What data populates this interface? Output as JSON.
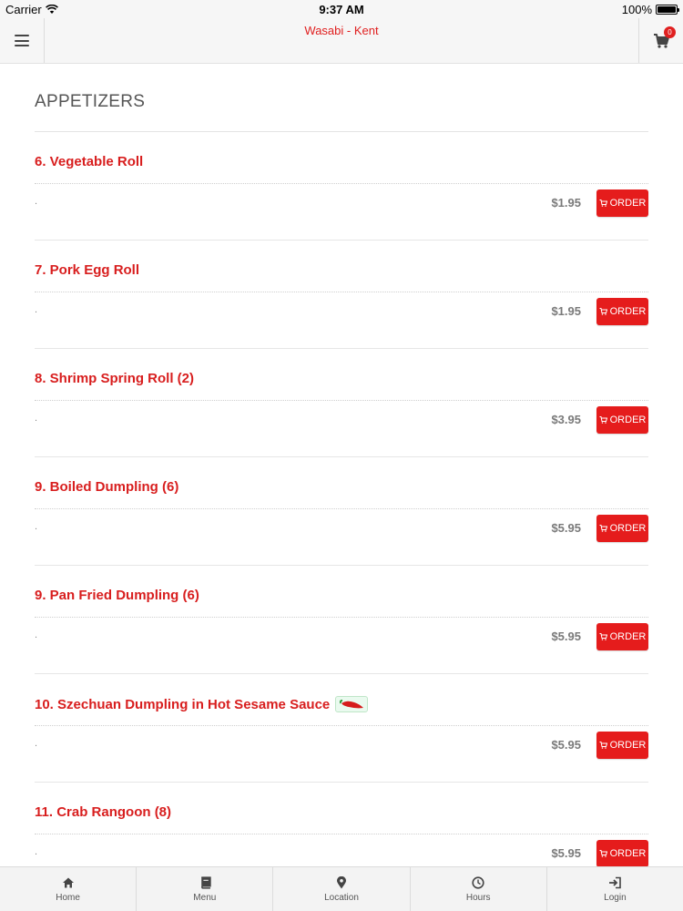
{
  "status_bar": {
    "carrier": "Carrier",
    "time": "9:37 AM",
    "battery": "100%"
  },
  "nav": {
    "title": "Wasabi - Kent",
    "cart_count": "0",
    "menu_icon": "hamburger-icon",
    "cart_icon": "cart-icon"
  },
  "section": {
    "title": "APPETIZERS"
  },
  "order_label": "ORDER",
  "items": [
    {
      "name": "6. Vegetable Roll",
      "desc": ".",
      "price": "$1.95"
    },
    {
      "name": "7. Pork Egg Roll",
      "desc": ".",
      "price": "$1.95"
    },
    {
      "name": "8. Shrimp Spring Roll (2)",
      "desc": ".",
      "price": "$3.95"
    },
    {
      "name": "9. Boiled Dumpling (6)",
      "desc": ".",
      "price": "$5.95"
    },
    {
      "name": "9. Pan Fried Dumpling (6)",
      "desc": ".",
      "price": "$5.95"
    },
    {
      "name": "10. Szechuan Dumpling in Hot Sesame Sauce",
      "desc": ".",
      "price": "$5.95",
      "spicy_icon": "chili-pepper-icon"
    },
    {
      "name": "11. Crab Rangoon (8)",
      "desc": ".",
      "price": "$5.95"
    }
  ],
  "tabs": [
    {
      "label": "Home",
      "icon": "home-icon"
    },
    {
      "label": "Menu",
      "icon": "book-icon"
    },
    {
      "label": "Location",
      "icon": "map-pin-icon"
    },
    {
      "label": "Hours",
      "icon": "clock-icon"
    },
    {
      "label": "Login",
      "icon": "login-icon"
    }
  ],
  "colors": {
    "accent": "#e51c1c",
    "title_red": "#d81e1e"
  }
}
